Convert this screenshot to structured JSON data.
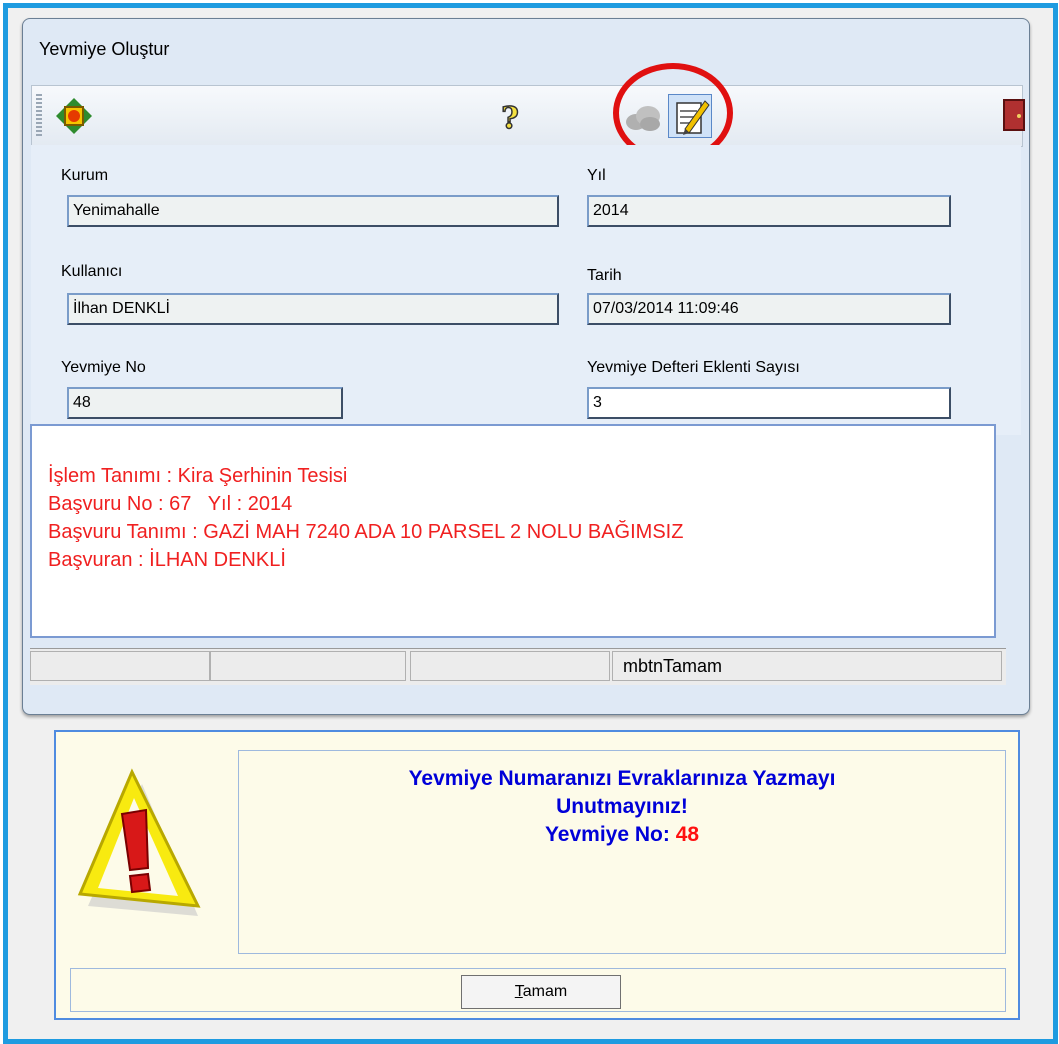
{
  "window": {
    "title": "Yevmiye Oluştur"
  },
  "toolbar": {
    "icons": [
      "navigate-icon",
      "help-icon",
      "cloud-icon",
      "pen-document-icon",
      "exit-door-icon"
    ]
  },
  "fields": {
    "kurum_label": "Kurum",
    "kurum_value": "Yenimahalle",
    "yil_label": "Yıl",
    "yil_value": "2014",
    "kullanici_label": "Kullanıcı",
    "kullanici_value": "İlhan DENKLİ",
    "tarih_label": "Tarih",
    "tarih_value": "07/03/2014 11:09:46",
    "yevmiye_no_label": "Yevmiye No",
    "yevmiye_no_value": "48",
    "ek_sayisi_label": "Yevmiye Defteri Eklenti Sayısı",
    "ek_sayisi_value": "3"
  },
  "info": {
    "lines": [
      "İşlem Tanımı : Kira Şerhinin Tesisi",
      "Başvuru No : 67   Yıl : 2014",
      "Başvuru Tanımı : GAZİ MAH 7240 ADA 10 PARSEL 2 NOLU BAĞIMSIZ",
      "Başvuran : İLHAN DENKLİ"
    ]
  },
  "statusbar": {
    "cell4": "mbtnTamam"
  },
  "alert": {
    "line1": "Yevmiye Numaranızı Evraklarınıza Yazmayı",
    "line2": "Unutmayınız!",
    "line3_prefix": "Yevmiye No:",
    "line3_number": "48",
    "button_accel": "T",
    "button_rest": "amam"
  },
  "colors": {
    "frame_border": "#1e9be0",
    "info_text": "#f02020",
    "alert_text": "#0000d8",
    "alert_number": "#ff1010"
  }
}
